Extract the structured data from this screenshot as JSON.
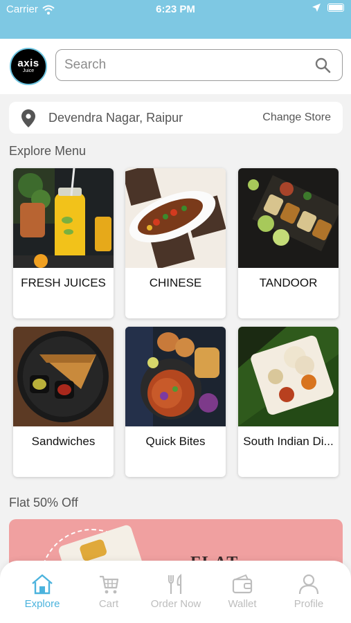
{
  "status_bar": {
    "carrier": "Carrier",
    "time": "6:23 PM"
  },
  "header": {
    "logo_text": "axis",
    "logo_subtext": "Juice",
    "search_placeholder": "Search"
  },
  "location": {
    "address": "Devendra Nagar, Raipur",
    "change_label": "Change Store"
  },
  "explore_menu": {
    "title": "Explore Menu",
    "items": [
      {
        "label": "FRESH JUICES",
        "image": "fresh-juices-photo"
      },
      {
        "label": "CHINESE",
        "image": "chinese-photo"
      },
      {
        "label": "TANDOOR",
        "image": "tandoor-photo"
      },
      {
        "label": "Sandwiches",
        "image": "sandwiches-photo"
      },
      {
        "label": "Quick Bites",
        "image": "quick-bites-photo"
      },
      {
        "label": "South Indian Di...",
        "image": "south-indian-photo"
      }
    ]
  },
  "offer": {
    "title": "Flat 50% Off",
    "banner_text": "FLAT"
  },
  "tabbar": {
    "items": [
      {
        "label": "Explore",
        "icon": "home-icon",
        "active": true
      },
      {
        "label": "Cart",
        "icon": "cart-icon",
        "active": false
      },
      {
        "label": "Order Now",
        "icon": "fork-knife-icon",
        "active": false
      },
      {
        "label": "Wallet",
        "icon": "wallet-icon",
        "active": false
      },
      {
        "label": "Profile",
        "icon": "person-icon",
        "active": false
      }
    ]
  },
  "colors": {
    "accent": "#4bb3dd",
    "status_bar": "#7ec8e3",
    "banner": "#f0a0a0",
    "inactive": "#bdbdbd"
  }
}
